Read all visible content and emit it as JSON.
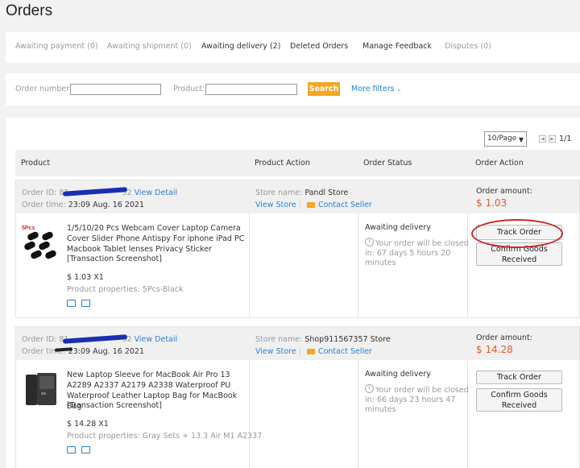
{
  "page": {
    "title": "Orders"
  },
  "tabs": [
    {
      "label": "Awaiting payment (0)"
    },
    {
      "label": "Awaiting shipment (0)"
    },
    {
      "label": "Awaiting delivery (2)"
    },
    {
      "label": "Deleted Orders"
    },
    {
      "label": "Manage Feedback"
    },
    {
      "label": "Disputes (0)"
    }
  ],
  "filters": {
    "order_number_label": "Order number:",
    "product_label": "Product:",
    "search_label": "Search",
    "more_filters_label": "More filters"
  },
  "pager": {
    "per_page": "10/Page",
    "page_text": "1/1"
  },
  "table": {
    "headers": [
      "Product",
      "Product Action",
      "Order Status",
      "Order Action"
    ]
  },
  "orders": [
    {
      "order_id_label": "Order ID:",
      "order_id_visible_start": "81",
      "order_id_visible_end": "52",
      "view_detail": "View Detail",
      "order_time_label": "Order time:",
      "order_time": "23:09 Aug. 16 2021",
      "store_label": "Store name:",
      "store_name": "Pandl Store",
      "view_store": "View Store",
      "contact_seller": "Contact Seller",
      "amount_label": "Order amount:",
      "amount": "$ 1.03",
      "product_title": "1/5/10/20 Pcs Webcam Cover Laptop Camera Cover Slider Phone Antispy For iphone iPad PC Macbook Tablet lenses Privacy Sticker",
      "snapshot": "[Transaction Screenshot]",
      "price": "$ 1.03 X1",
      "properties": "Product properties: 5Pcs-Black",
      "status": "Awaiting delivery",
      "wait_text": "Your order will be closed in: 67 days 5 hours 20 minutes",
      "track_order": "Track Order",
      "confirm_goods": "Confirm Goods Received",
      "thumb_badge": "5Pcs"
    },
    {
      "order_id_label": "Order ID:",
      "order_id_visible_start": "81",
      "order_id_visible_end": "52",
      "view_detail": "View Detail",
      "order_time_label": "Order time:",
      "order_time": "23:09 Aug. 16 2021",
      "store_label": "Store name:",
      "store_name": "Shop911567357 Store",
      "view_store": "View Store",
      "contact_seller": "Contact Seller",
      "amount_label": "Order amount:",
      "amount": "$ 14.28",
      "product_title": "New Laptop Sleeve for MacBook Air Pro 13 A2289 A2337 A2179 A2338 Waterproof PU Waterproof Leather Laptop Bag for MacBook Bag",
      "snapshot": "[Transaction Screenshot]",
      "price": "$ 14.28 X1",
      "properties": "Product properties: Gray Sets + 13.3 Air M1 A2337",
      "status": "Awaiting delivery",
      "wait_text": "Your order will be closed in: 66 days 23 hours 47 minutes",
      "track_order": "Track Order",
      "confirm_goods": "Confirm Goods Received"
    }
  ],
  "colors": {
    "accent": "#f5a623",
    "link": "#2a7fd4",
    "amount": "#e35b2a",
    "annotation": "#c62828"
  }
}
